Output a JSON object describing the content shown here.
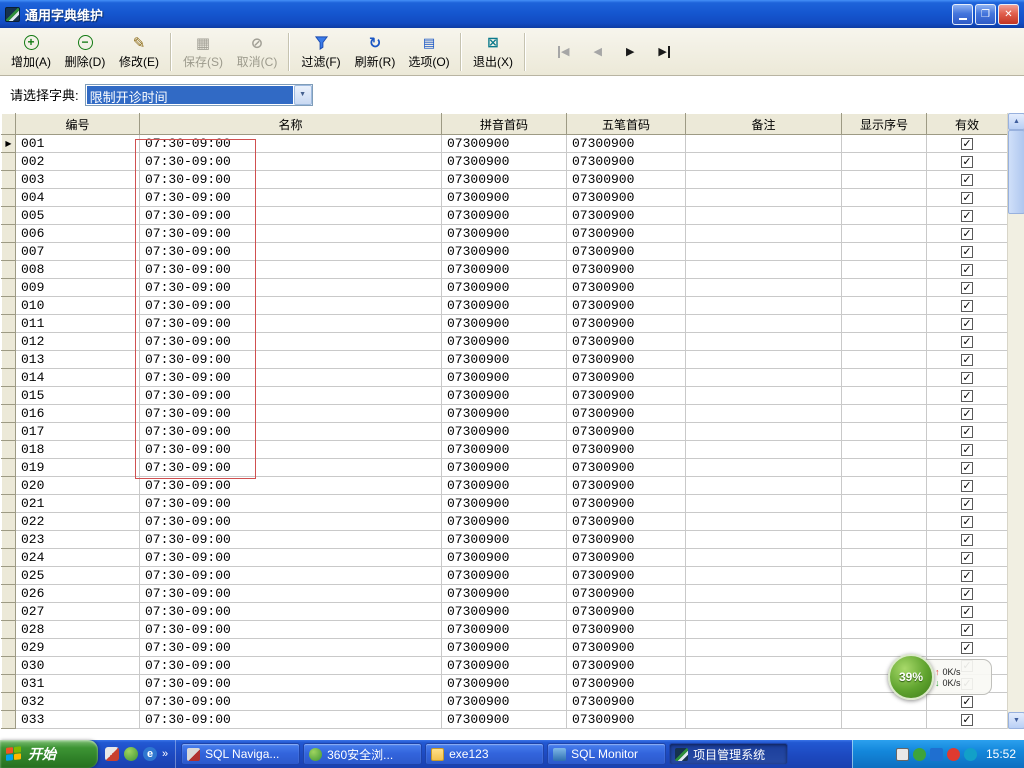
{
  "window": {
    "title": "通用字典维护"
  },
  "toolbar": {
    "buttons": [
      {
        "label": "增加(A)"
      },
      {
        "label": "删除(D)"
      },
      {
        "label": "修改(E)"
      },
      {
        "label": "保存(S)"
      },
      {
        "label": "取消(C)"
      },
      {
        "label": "过滤(F)"
      },
      {
        "label": "刷新(R)"
      },
      {
        "label": "选项(O)"
      },
      {
        "label": "退出(X)"
      }
    ]
  },
  "selector": {
    "label": "请选择字典:",
    "value": "限制开诊时间"
  },
  "grid": {
    "columns": [
      "编号",
      "名称",
      "拼音首码",
      "五笔首码",
      "备注",
      "显示序号",
      "有效"
    ],
    "rows": [
      [
        "001",
        "07:30-09:00",
        "07300900",
        "07300900",
        "",
        "",
        true
      ],
      [
        "002",
        "07:30-09:00",
        "07300900",
        "07300900",
        "",
        "",
        true
      ],
      [
        "003",
        "07:30-09:00",
        "07300900",
        "07300900",
        "",
        "",
        true
      ],
      [
        "004",
        "07:30-09:00",
        "07300900",
        "07300900",
        "",
        "",
        true
      ],
      [
        "005",
        "07:30-09:00",
        "07300900",
        "07300900",
        "",
        "",
        true
      ],
      [
        "006",
        "07:30-09:00",
        "07300900",
        "07300900",
        "",
        "",
        true
      ],
      [
        "007",
        "07:30-09:00",
        "07300900",
        "07300900",
        "",
        "",
        true
      ],
      [
        "008",
        "07:30-09:00",
        "07300900",
        "07300900",
        "",
        "",
        true
      ],
      [
        "009",
        "07:30-09:00",
        "07300900",
        "07300900",
        "",
        "",
        true
      ],
      [
        "010",
        "07:30-09:00",
        "07300900",
        "07300900",
        "",
        "",
        true
      ],
      [
        "011",
        "07:30-09:00",
        "07300900",
        "07300900",
        "",
        "",
        true
      ],
      [
        "012",
        "07:30-09:00",
        "07300900",
        "07300900",
        "",
        "",
        true
      ],
      [
        "013",
        "07:30-09:00",
        "07300900",
        "07300900",
        "",
        "",
        true
      ],
      [
        "014",
        "07:30-09:00",
        "07300900",
        "07300900",
        "",
        "",
        true
      ],
      [
        "015",
        "07:30-09:00",
        "07300900",
        "07300900",
        "",
        "",
        true
      ],
      [
        "016",
        "07:30-09:00",
        "07300900",
        "07300900",
        "",
        "",
        true
      ],
      [
        "017",
        "07:30-09:00",
        "07300900",
        "07300900",
        "",
        "",
        true
      ],
      [
        "018",
        "07:30-09:00",
        "07300900",
        "07300900",
        "",
        "",
        true
      ],
      [
        "019",
        "07:30-09:00",
        "07300900",
        "07300900",
        "",
        "",
        true
      ],
      [
        "020",
        "07:30-09:00",
        "07300900",
        "07300900",
        "",
        "",
        true
      ],
      [
        "021",
        "07:30-09:00",
        "07300900",
        "07300900",
        "",
        "",
        true
      ],
      [
        "022",
        "07:30-09:00",
        "07300900",
        "07300900",
        "",
        "",
        true
      ],
      [
        "023",
        "07:30-09:00",
        "07300900",
        "07300900",
        "",
        "",
        true
      ],
      [
        "024",
        "07:30-09:00",
        "07300900",
        "07300900",
        "",
        "",
        true
      ],
      [
        "025",
        "07:30-09:00",
        "07300900",
        "07300900",
        "",
        "",
        true
      ],
      [
        "026",
        "07:30-09:00",
        "07300900",
        "07300900",
        "",
        "",
        true
      ],
      [
        "027",
        "07:30-09:00",
        "07300900",
        "07300900",
        "",
        "",
        true
      ],
      [
        "028",
        "07:30-09:00",
        "07300900",
        "07300900",
        "",
        "",
        true
      ],
      [
        "029",
        "07:30-09:00",
        "07300900",
        "07300900",
        "",
        "",
        true
      ],
      [
        "030",
        "07:30-09:00",
        "07300900",
        "07300900",
        "",
        "",
        true
      ],
      [
        "031",
        "07:30-09:00",
        "07300900",
        "07300900",
        "",
        "",
        true
      ],
      [
        "032",
        "07:30-09:00",
        "07300900",
        "07300900",
        "",
        "",
        true
      ],
      [
        "033",
        "07:30-09:00",
        "07300900",
        "07300900",
        "",
        "",
        true
      ]
    ]
  },
  "net_widget": {
    "percent": "39%",
    "up_speed": "0K/s",
    "down_speed": "0K/s"
  },
  "taskbar": {
    "start_label": "开始",
    "tasks": [
      {
        "label": "SQL Naviga..."
      },
      {
        "label": "360安全浏..."
      },
      {
        "label": "exe123"
      },
      {
        "label": "SQL Monitor"
      },
      {
        "label": "项目管理系统"
      }
    ],
    "clock": "15:52"
  },
  "icons": {
    "add": "+",
    "delete": "−",
    "edit": "✎",
    "save": "▦",
    "cancel": "⊘",
    "refresh": "↻",
    "options": "▤",
    "exit": "⊠",
    "dropdown": "▼",
    "row_marker": "▶",
    "check": "✓",
    "scroll_up": "▲",
    "scroll_down": "▼",
    "nav_first": "◀",
    "nav_prev": "◀",
    "nav_next": "▶",
    "nav_last": "▶",
    "up_arrow": "↑",
    "down_arrow": "↓",
    "quick_launch_more": "»",
    "ie_letter": "e"
  }
}
